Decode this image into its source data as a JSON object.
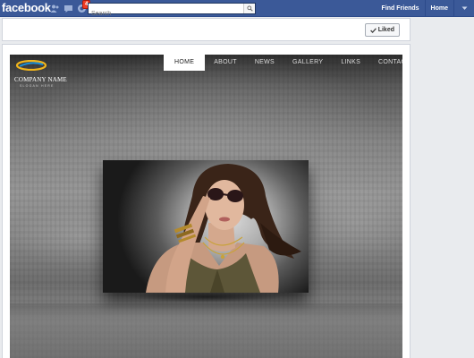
{
  "topbar": {
    "logo": "facebook",
    "notification_count": "4",
    "search_placeholder": "Search",
    "find_friends": "Find Friends",
    "home": "Home"
  },
  "page_header": {
    "liked_label": "Liked",
    "liked_icon": "checkmark-icon"
  },
  "site": {
    "brand_name": "COMPANY NAME",
    "brand_tagline": "SLOGAN HERE",
    "nav": [
      {
        "label": "HOME",
        "active": true
      },
      {
        "label": "ABOUT",
        "active": false
      },
      {
        "label": "NEWS",
        "active": false
      },
      {
        "label": "GALLERY",
        "active": false
      },
      {
        "label": "LINKS",
        "active": false
      },
      {
        "label": "CONTACT",
        "active": false
      }
    ],
    "photo_subject": "woman-with-sunglasses"
  },
  "colors": {
    "facebook_blue": "#3b5998",
    "page_bg": "#e9ebee",
    "nav_active_bg": "#ffffff",
    "notification_red": "#f03d25"
  }
}
